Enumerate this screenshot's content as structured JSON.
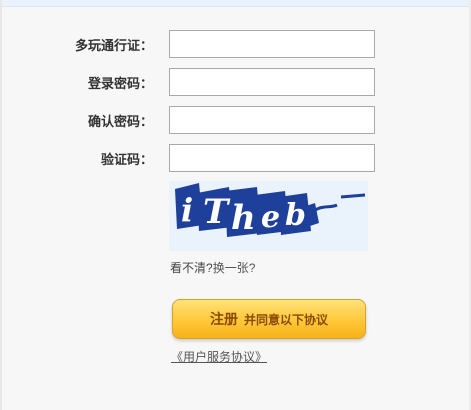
{
  "form": {
    "fields": [
      {
        "label": "多玩通行证：",
        "value": ""
      },
      {
        "label": "登录密码：",
        "value": ""
      },
      {
        "label": "确认密码：",
        "value": ""
      },
      {
        "label": "验证码：",
        "value": ""
      }
    ],
    "captcha": {
      "text": "iThebi"
    },
    "refresh": {
      "prefix": "看不清?",
      "link": "换一张?"
    },
    "register_button": {
      "main": "注册",
      "sub": "并同意以下协议"
    },
    "agreement_link": "《用户服务协议》"
  },
  "colors": {
    "button_gradient_top": "#ffe27a",
    "button_gradient_bottom": "#f6b21a",
    "button_text": "#8a4a05",
    "captcha_blue": "#1e3f9a"
  }
}
